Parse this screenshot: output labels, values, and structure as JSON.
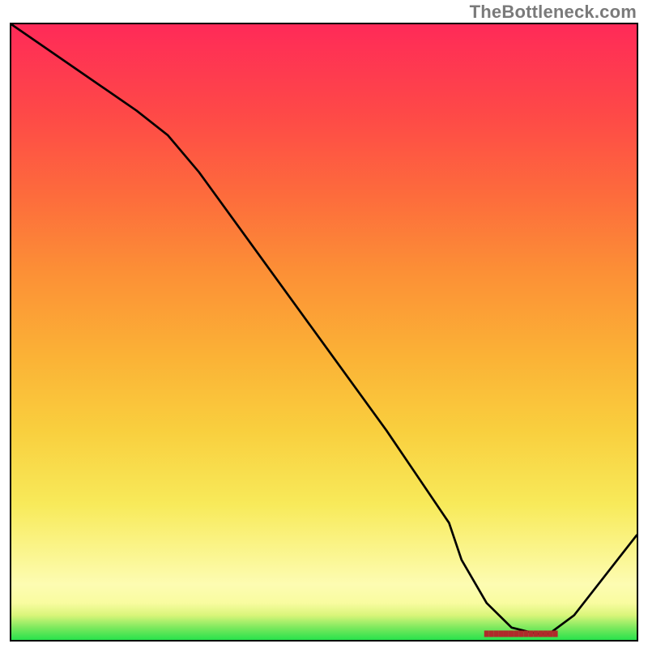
{
  "watermark": "TheBottleneck.com",
  "colors": {
    "curve_stroke": "#000000",
    "marker_fill": "#b02b2b",
    "border": "#000000",
    "gradient_stops": [
      "#28e24c",
      "#7de95e",
      "#d9f57a",
      "#f9fca0",
      "#fdfcb2",
      "#fbf796",
      "#f8ea5a",
      "#f9cf3e",
      "#fbb236",
      "#fc8f36",
      "#fd6c3c",
      "#fe4a47",
      "#ff2a58"
    ]
  },
  "chart_data": {
    "type": "line",
    "title": "",
    "xlabel": "",
    "ylabel": "",
    "xlim": [
      0,
      100
    ],
    "ylim": [
      0,
      100
    ],
    "grid": false,
    "legend": false,
    "series": [
      {
        "name": "bottleneck_curve",
        "x": [
          0,
          10,
          20,
          25,
          30,
          40,
          50,
          60,
          70,
          72,
          76,
          80,
          84,
          86,
          90,
          100
        ],
        "values": [
          100,
          93,
          86,
          82,
          76,
          62,
          48,
          34,
          19,
          13,
          6,
          2,
          1,
          1,
          4,
          17
        ]
      }
    ],
    "markers": {
      "name": "marker_strip",
      "y": 1.0,
      "x_start": 76,
      "x_end": 87,
      "count": 15
    }
  }
}
